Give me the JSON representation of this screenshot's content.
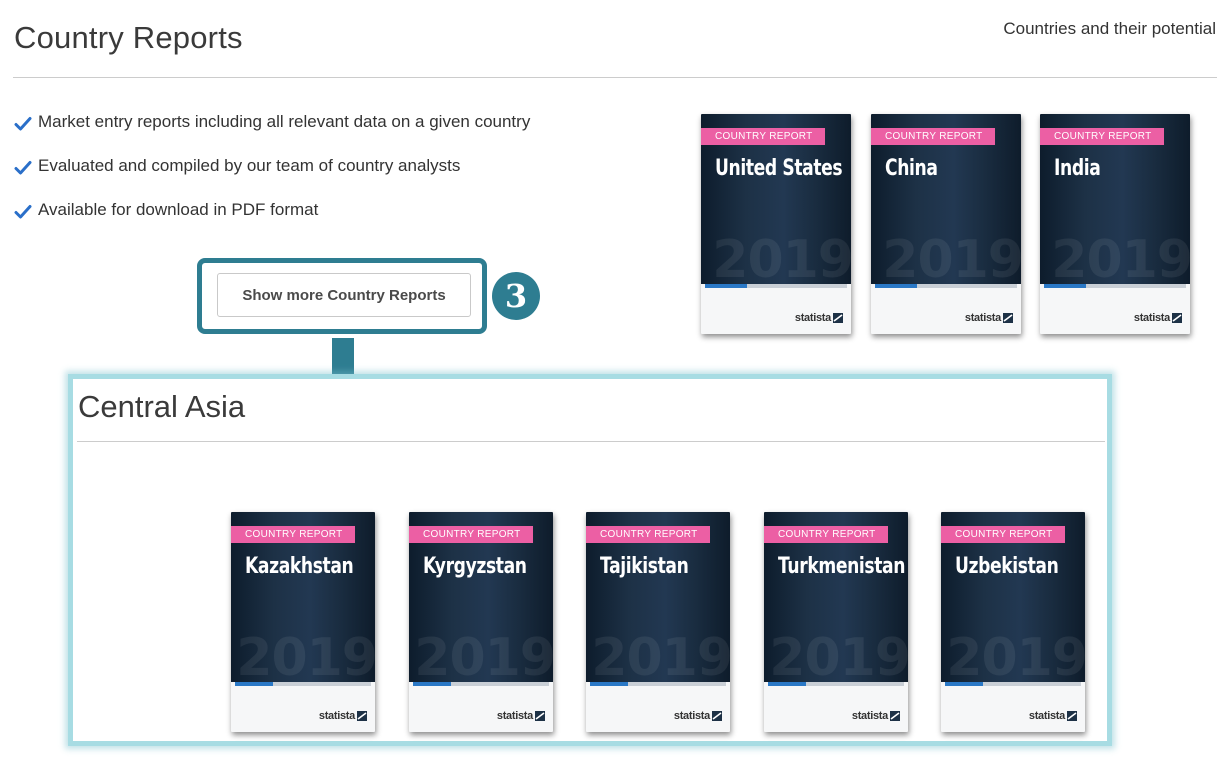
{
  "header": {
    "title": "Country Reports",
    "subtitle": "Countries and their potential"
  },
  "features": [
    "Market entry reports including all relevant data on a given country",
    "Evaluated and compiled by our team of country analysts",
    "Available for download in PDF format"
  ],
  "show_more_button": "Show more Country Reports",
  "step_badge": "3",
  "book_common": {
    "label": "COUNTRY REPORT",
    "year": "2019",
    "brand": "statista",
    "cover_color": "#1d3146",
    "label_color": "#ec5fa4",
    "accent_color": "#2e7d91"
  },
  "featured_reports": [
    {
      "name": "United States"
    },
    {
      "name": "China"
    },
    {
      "name": "India"
    }
  ],
  "region_panel": {
    "title": "Central Asia",
    "reports": [
      {
        "name": "Kazakhstan"
      },
      {
        "name": "Kyrgyzstan"
      },
      {
        "name": "Tajikistan"
      },
      {
        "name": "Turkmenistan"
      },
      {
        "name": "Uzbekistan"
      }
    ]
  }
}
